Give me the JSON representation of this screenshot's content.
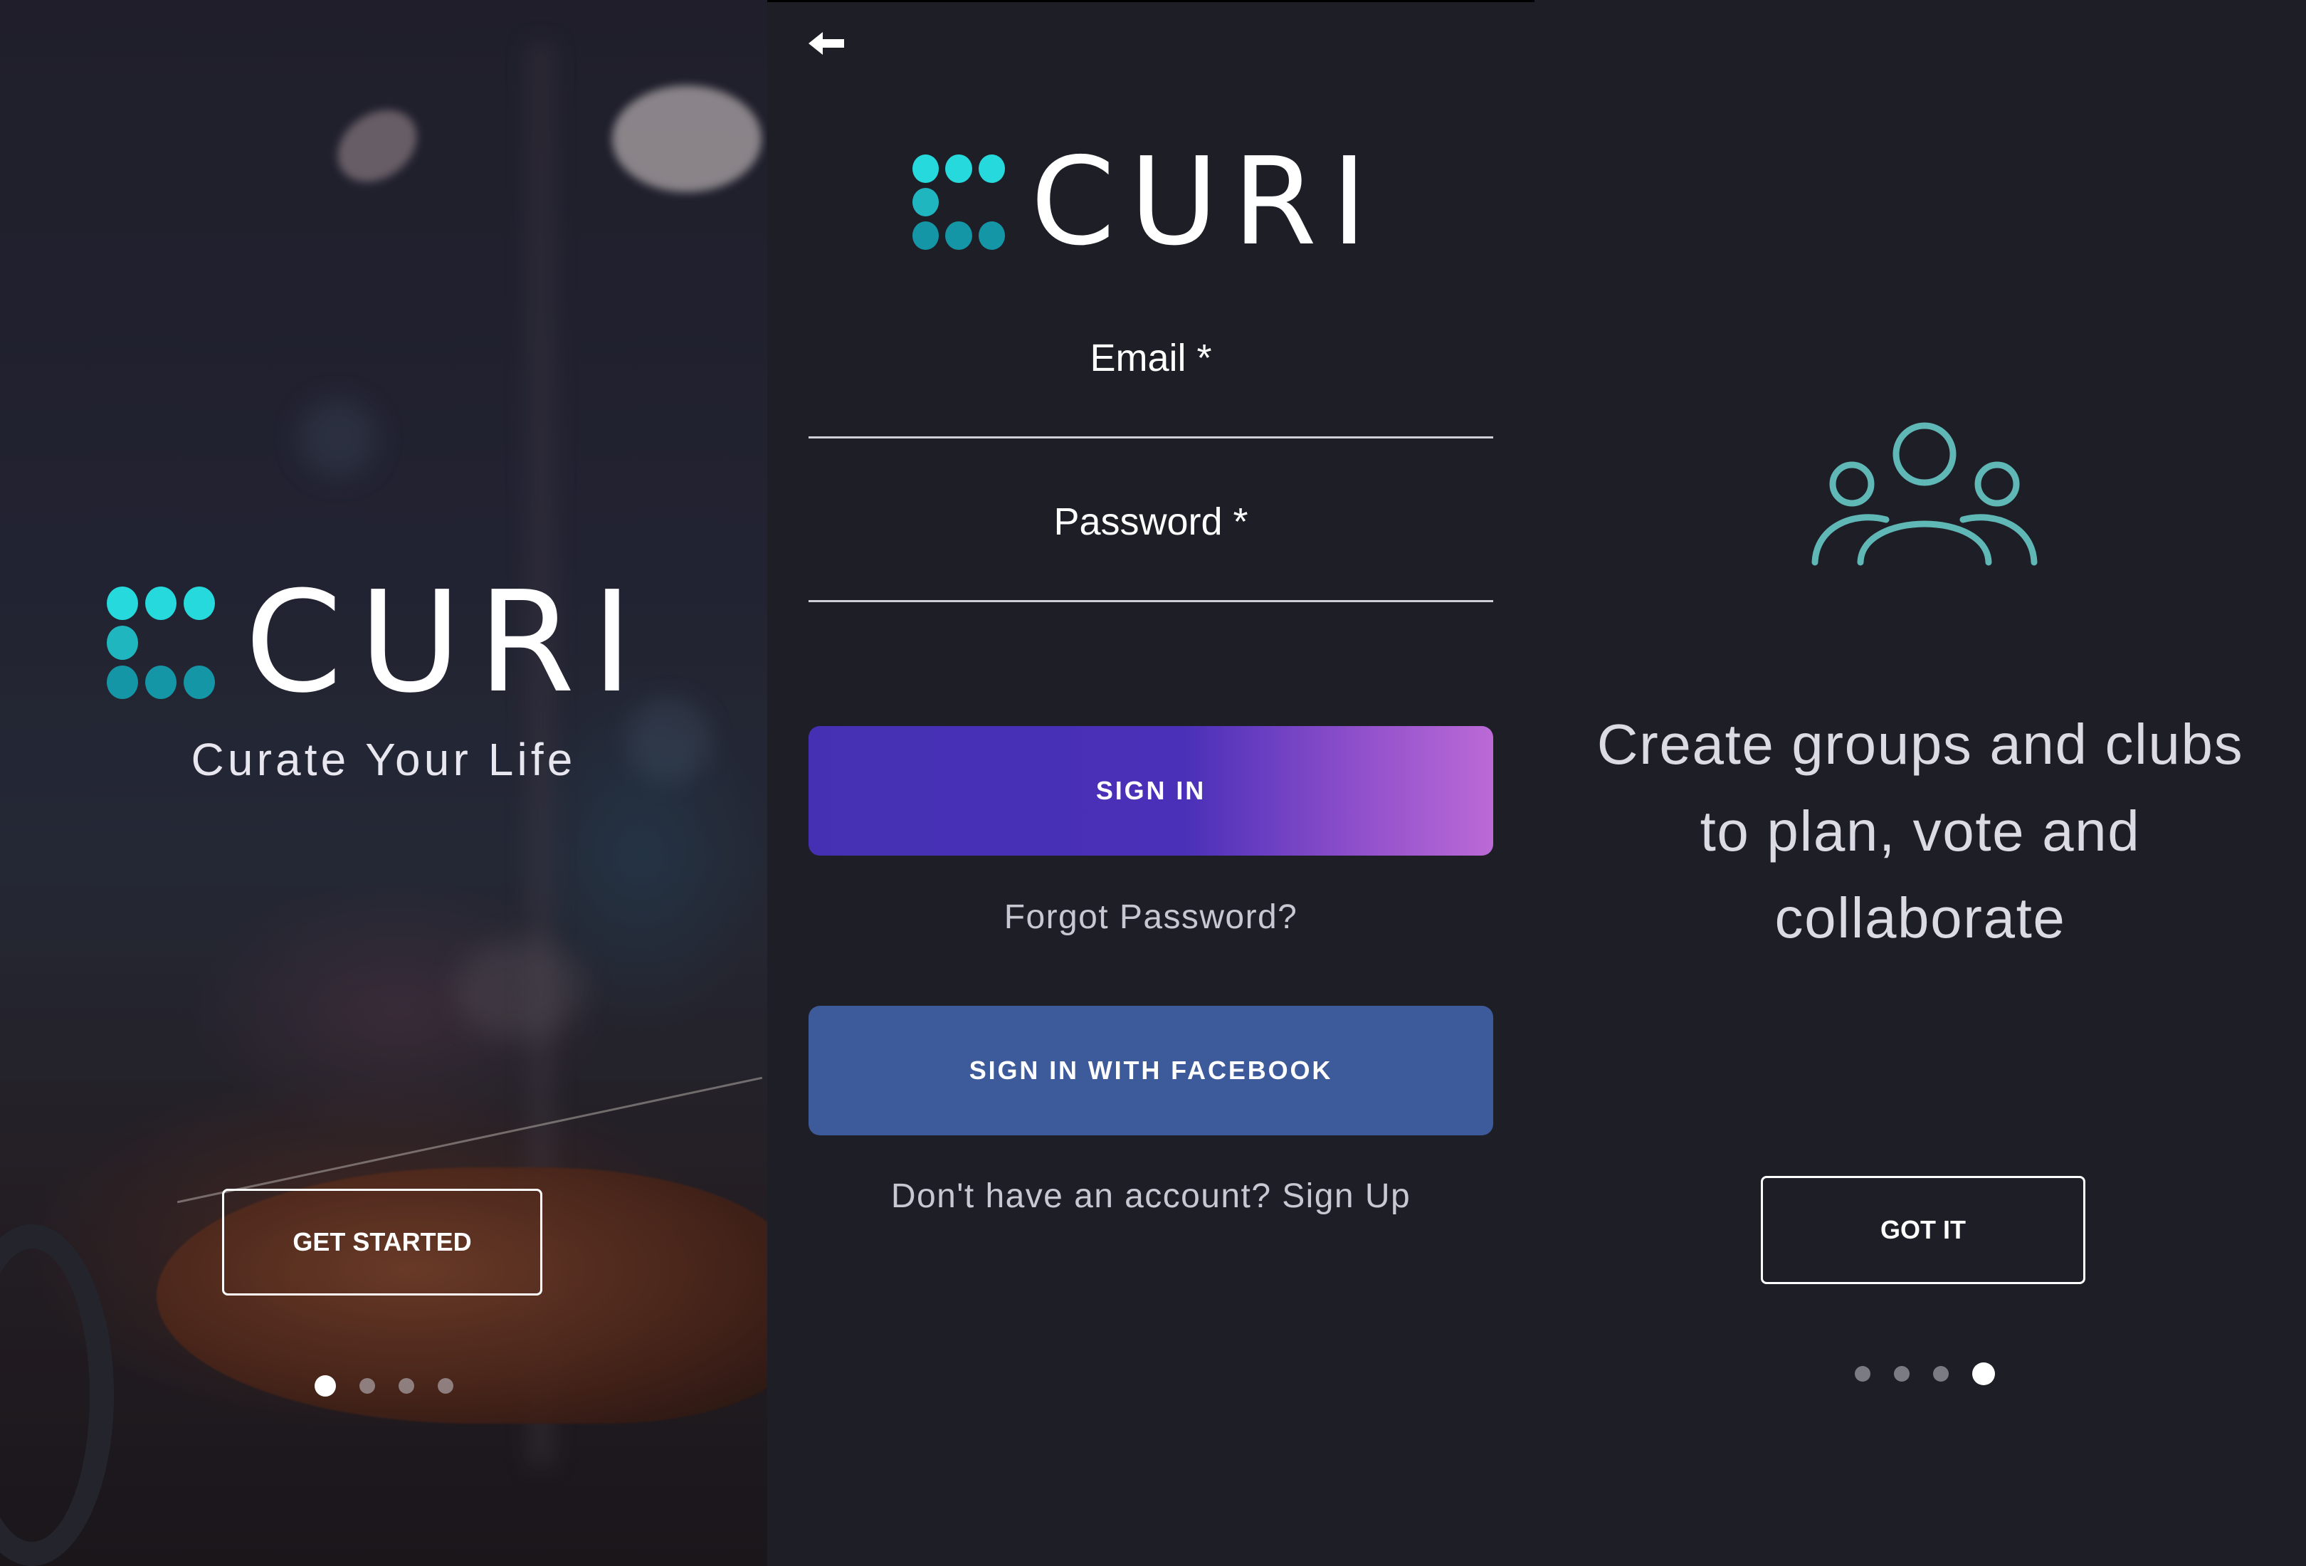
{
  "colors": {
    "logo_dot_bright": "#25d9dc",
    "logo_dot_mid": "#1fb6c0",
    "logo_dot_dark": "#1596a6",
    "signin_gradient_start": "#4530b3",
    "signin_gradient_end": "#bb6ad6",
    "facebook_blue": "#3d5a9a",
    "groups_icon_teal": "#5fb8b6",
    "background_dark": "#1e1e27"
  },
  "welcome": {
    "logo_text": "CURI",
    "tagline": "Curate Your Life",
    "get_started_label": "GET STARTED",
    "pager": {
      "total": 4,
      "active_index": 0
    }
  },
  "signin": {
    "back_icon": "arrow-left-icon",
    "logo_text": "CURI",
    "email_label": "Email *",
    "password_label": "Password *",
    "signin_label": "SIGN IN",
    "forgot_password_label": "Forgot Password?",
    "facebook_label": "SIGN IN WITH FACEBOOK",
    "signup_prompt": "Don't have an account? Sign Up"
  },
  "groups": {
    "icon": "people-group-icon",
    "feature_line1": "Create groups and clubs",
    "feature_line2": "to plan, vote and",
    "feature_line3": "collaborate",
    "got_it_label": "GOT IT",
    "pager": {
      "total": 4,
      "active_index": 3
    }
  }
}
